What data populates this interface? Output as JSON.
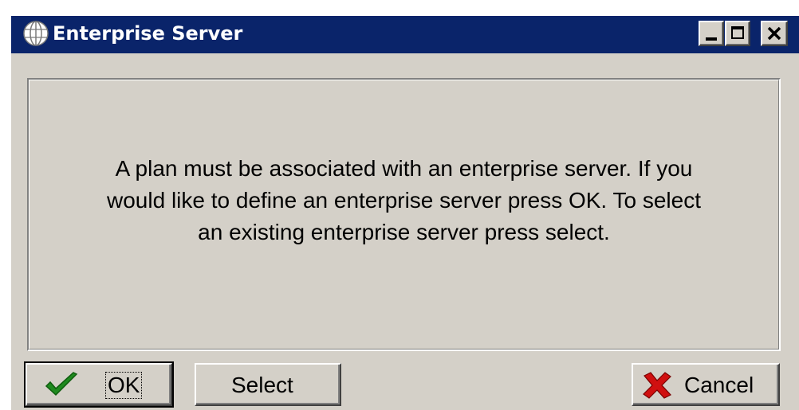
{
  "window": {
    "title": "Enterprise Server",
    "title_color": "#ffffff",
    "titlebar_color": "#0a246a",
    "background_color": "#d4d0c8"
  },
  "titlebar_buttons": {
    "minimize_icon": "minimize-icon",
    "maximize_icon": "maximize-icon",
    "close_icon": "close-icon"
  },
  "message": {
    "text": "A plan must be associated with an enterprise server. If you\nwould like to define an enterprise server press OK.  To select\nan existing enterprise server press select."
  },
  "buttons": {
    "ok": {
      "label": "OK",
      "icon": "checkmark-icon",
      "icon_color": "#1f8a1f"
    },
    "select": {
      "label": "Select"
    },
    "cancel": {
      "label": "Cancel",
      "icon": "red-x-icon",
      "icon_color": "#d01010"
    }
  }
}
